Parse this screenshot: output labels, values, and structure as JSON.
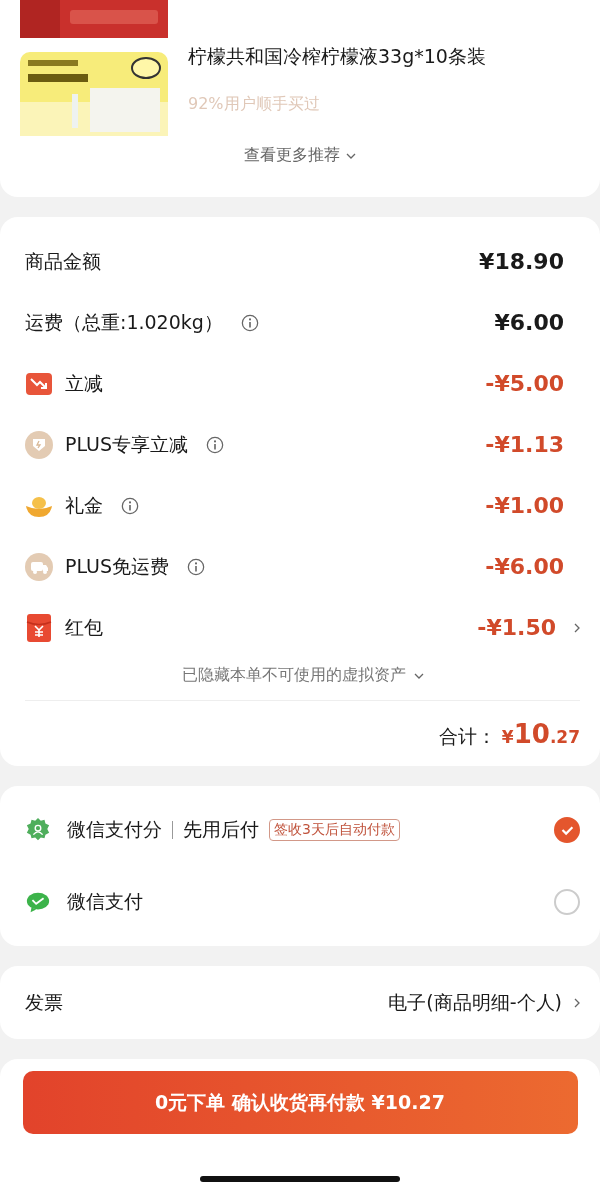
{
  "recommend": {
    "title": "柠檬共和国冷榨柠檬液33g*10条装",
    "social": "92%用户顺手买过",
    "more": "查看更多推荐"
  },
  "fees": [
    {
      "kind": "charge",
      "label": "商品金额",
      "info": false,
      "amount": "¥18.90",
      "chevron": false
    },
    {
      "kind": "charge",
      "label": "运费（总重:1.020kg）",
      "info": true,
      "amount": "¥6.00",
      "chevron": false
    },
    {
      "kind": "instant",
      "label": "立减",
      "info": false,
      "amount": "-¥5.00",
      "chevron": false
    },
    {
      "kind": "plus",
      "label": "PLUS专享立减",
      "info": true,
      "amount": "-¥1.13",
      "chevron": false
    },
    {
      "kind": "gift",
      "label": "礼金",
      "info": true,
      "amount": "-¥1.00",
      "chevron": false
    },
    {
      "kind": "freeship",
      "label": "PLUS免运费",
      "info": true,
      "amount": "-¥6.00",
      "chevron": false
    },
    {
      "kind": "packet",
      "label": "红包",
      "info": false,
      "amount": "-¥1.50",
      "chevron": true
    }
  ],
  "hidden_note": "已隐藏本单不可使用的虚拟资产",
  "total": {
    "label": "合计：",
    "currency": "¥",
    "integer": "10",
    "decimal": ".27"
  },
  "payments": [
    {
      "kind": "score",
      "name": "微信支付分",
      "sub": "先用后付",
      "tag": "签收3天后自动付款",
      "selected": true
    },
    {
      "kind": "wallet",
      "name": "微信支付",
      "selected": false
    }
  ],
  "invoice": {
    "label": "发票",
    "value": "电子(商品明细-个人)"
  },
  "submit": "0元下单 确认收货再付款 ¥10.27"
}
